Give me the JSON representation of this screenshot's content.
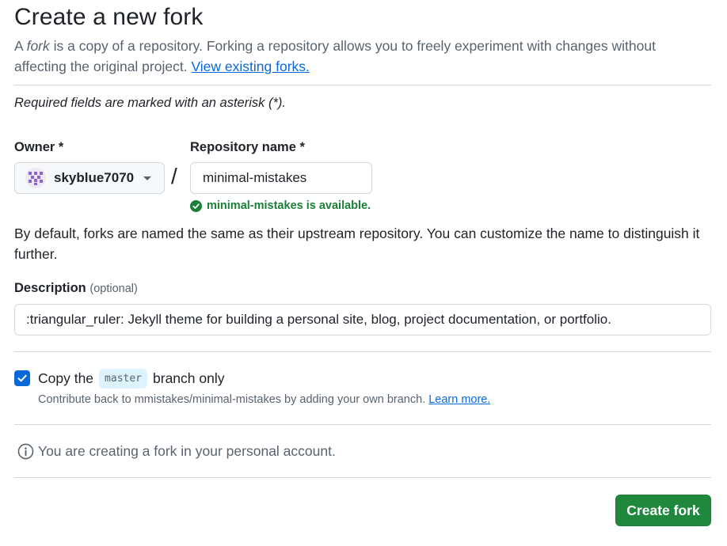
{
  "header": {
    "title": "Create a new fork",
    "intro_a": "A ",
    "intro_fork": "fork",
    "intro_b": " is a copy of a repository. Forking a repository allows you to freely experiment with changes without affecting the original project. ",
    "intro_link": "View existing forks."
  },
  "required_note": "Required fields are marked with an asterisk (*).",
  "owner": {
    "label": "Owner *",
    "value": "skyblue7070",
    "avatar_color": "#8a63d2"
  },
  "slash": "/",
  "repo": {
    "label": "Repository name *",
    "value": "minimal-mistakes",
    "availability": "minimal-mistakes is available.",
    "availability_color": "#1a7f37"
  },
  "default_note": "By default, forks are named the same as their upstream repository. You can customize the name to distinguish it further.",
  "description": {
    "label": "Description",
    "optional": "(optional)",
    "value": ":triangular_ruler: Jekyll theme for building a personal site, blog, project documentation, or portfolio."
  },
  "copy_branch": {
    "checked": true,
    "prefix": "Copy the",
    "branch": "master",
    "suffix": "branch only",
    "contrib_text": "Contribute back to mmistakes/minimal-mistakes by adding your own branch.",
    "learn_more": "Learn more."
  },
  "info": {
    "text": "You are creating a fork in your personal account."
  },
  "submit": {
    "label": "Create fork",
    "color": "#1f883d"
  }
}
